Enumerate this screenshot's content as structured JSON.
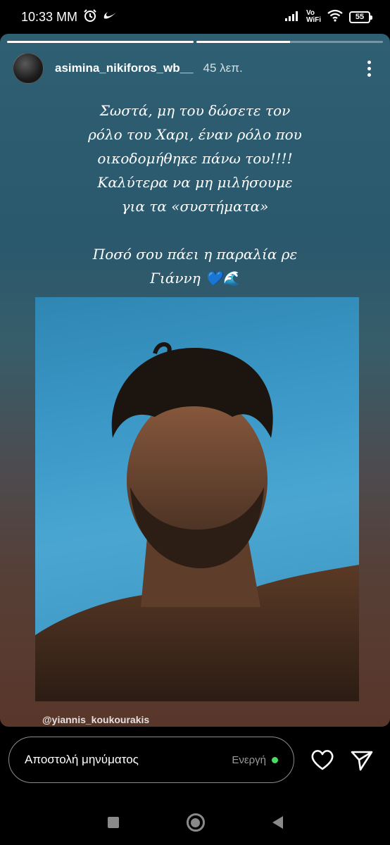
{
  "status_bar": {
    "time": "10:33 MM",
    "vowifi_top": "Vo",
    "vowifi_bottom": "WiFi",
    "battery": "55"
  },
  "story": {
    "progress": [
      1,
      0.5
    ],
    "username": "asimina_nikiforos_wb__",
    "time_ago": "45 λεπ.",
    "caption_p1": "Σωστά, μη του δώσετε τον\nρόλο του Χαρι, έναν ρόλο που\nοικοδομήθηκε πάνω του!!!!\nΚαλύτερα να μη μιλήσουμε\nγια τα «συστήματα»",
    "caption_p2": "Ποσό σου πάει η παραλία ρε\nΓιάννη 💙🌊",
    "photo_tag": "@yiannis_koukourakis"
  },
  "reply": {
    "placeholder": "Αποστολή μηνύματος",
    "status": "Ενεργή",
    "status_color": "#4cd964"
  },
  "icons": [
    "alarm-icon",
    "nike-icon",
    "signal-icon",
    "wifi-icon",
    "battery-icon",
    "more-icon",
    "heart-icon",
    "send-icon",
    "recents-icon",
    "home-icon",
    "back-icon"
  ]
}
